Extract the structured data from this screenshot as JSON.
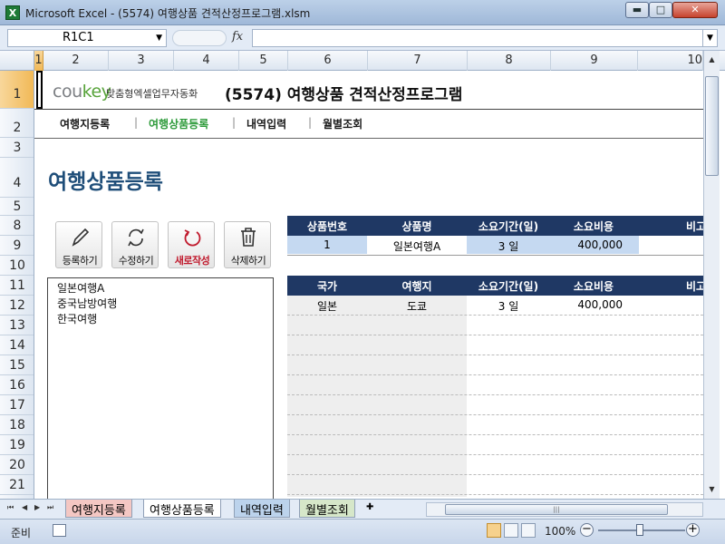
{
  "window": {
    "title": "Microsoft Excel - (5574) 여행상품 견적산정프로그램.xlsm",
    "app_icon": "X",
    "min_label": "▬",
    "max_label": "□",
    "close_label": "✕"
  },
  "formula_bar": {
    "name_box": "R1C1",
    "fx_label": "fx",
    "formula": ""
  },
  "columns": [
    "1",
    "2",
    "3",
    "4",
    "5",
    "6",
    "7",
    "8",
    "9",
    "10"
  ],
  "rows": [
    "1",
    "2",
    "3",
    "4",
    "5",
    "8",
    "9",
    "10",
    "11",
    "12",
    "13",
    "14",
    "15",
    "16",
    "17",
    "18",
    "19",
    "20",
    "21"
  ],
  "brand": {
    "logo_cou": "cou",
    "logo_key": "key",
    "tagline": "맞춤형엑셀업무자동화",
    "title": "(5574) 여행상품 견적산정프로그램"
  },
  "nav": {
    "items": [
      "여행지등록",
      "여행상품등록",
      "내역입력",
      "월별조회"
    ],
    "separator": "|"
  },
  "page": {
    "heading": "여행상품등록"
  },
  "actions": {
    "register": "등록하기",
    "modify": "수정하기",
    "new": "새로작성",
    "delete": "삭제하기"
  },
  "product_list": [
    "일본여행A",
    "중국남방여행",
    "한국여행"
  ],
  "product_table": {
    "headers": [
      "상품번호",
      "상품명",
      "소요기간(일)",
      "소요비용",
      "비고"
    ],
    "row": [
      "1",
      "일본여행A",
      "3 일",
      "400,000",
      ""
    ]
  },
  "detail_table": {
    "headers": [
      "국가",
      "여행지",
      "소요기간(일)",
      "소요비용",
      "비고"
    ],
    "row": [
      "일본",
      "도쿄",
      "3 일",
      "400,000",
      ""
    ]
  },
  "sheet_tabs": [
    "여행지등록",
    "여행상품등록",
    "내역입력",
    "월별조회"
  ],
  "status": {
    "ready": "준비",
    "zoom": "100%"
  },
  "colors": {
    "header_navy": "#1f3864",
    "heading_blue": "#1f4e79",
    "brand_green": "#57a33a",
    "nav_active": "#2e9b3b",
    "new_red": "#c0192c"
  }
}
